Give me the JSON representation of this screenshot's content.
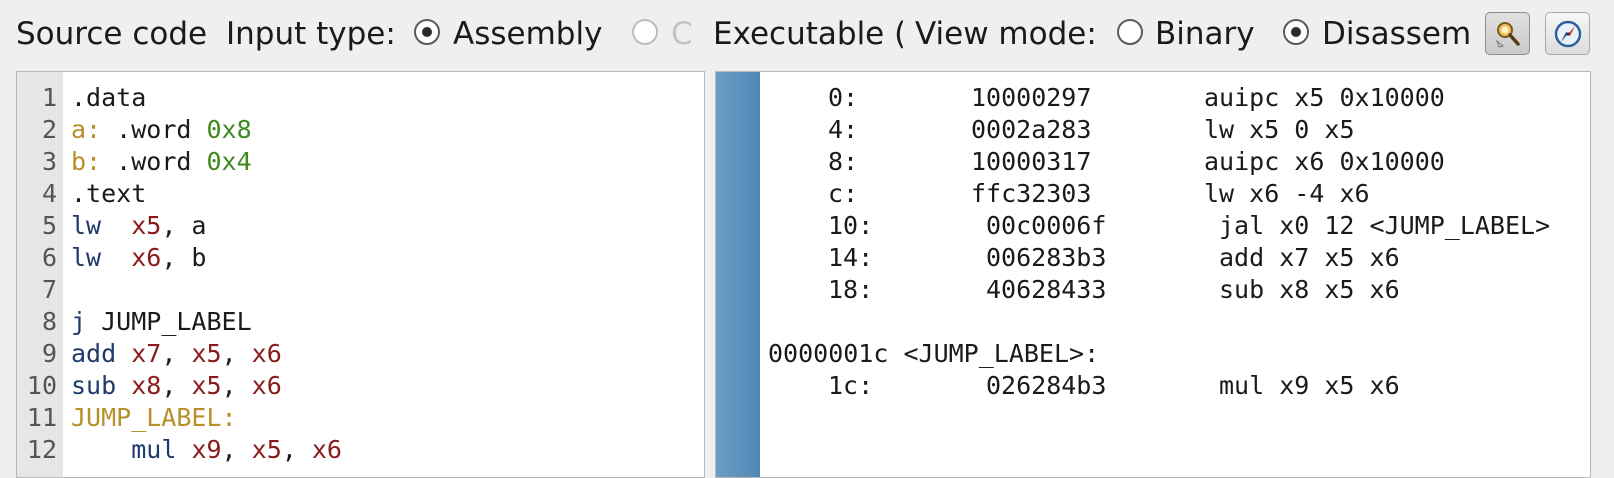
{
  "toolbar": {
    "source_code_label": "Source code",
    "input_type_label": "Input type:",
    "input_options": [
      {
        "label": "Assembly",
        "checked": true,
        "disabled": false
      },
      {
        "label": "C",
        "checked": false,
        "disabled": true
      },
      {
        "label": "Executable (",
        "checked": false,
        "disabled": false
      }
    ],
    "view_mode_label": "View mode:",
    "view_options": [
      {
        "label": "Binary",
        "checked": false
      },
      {
        "label": "Disassembly",
        "checked": true
      }
    ],
    "buttons": [
      {
        "icon": "inspect-icon",
        "active": true
      },
      {
        "icon": "compass-icon",
        "active": false
      }
    ]
  },
  "editor": {
    "line_numbers": [
      "1",
      "2",
      "3",
      "4",
      "5",
      "6",
      "7",
      "8",
      "9",
      "10",
      "11",
      "12"
    ],
    "lines": [
      [
        {
          "t": ".data",
          "c": "plain"
        }
      ],
      [
        {
          "t": "a:",
          "c": "lbl"
        },
        {
          "t": " .word ",
          "c": "plain"
        },
        {
          "t": "0x8",
          "c": "num"
        }
      ],
      [
        {
          "t": "b:",
          "c": "lbl"
        },
        {
          "t": " .word ",
          "c": "plain"
        },
        {
          "t": "0x4",
          "c": "num"
        }
      ],
      [
        {
          "t": ".text",
          "c": "plain"
        }
      ],
      [
        {
          "t": "lw",
          "c": "kw"
        },
        {
          "t": "  ",
          "c": "plain"
        },
        {
          "t": "x5",
          "c": "reg"
        },
        {
          "t": ", a",
          "c": "plain"
        }
      ],
      [
        {
          "t": "lw",
          "c": "kw"
        },
        {
          "t": "  ",
          "c": "plain"
        },
        {
          "t": "x6",
          "c": "reg"
        },
        {
          "t": ", b",
          "c": "plain"
        }
      ],
      [],
      [
        {
          "t": "j",
          "c": "kw"
        },
        {
          "t": " JUMP_LABEL",
          "c": "plain"
        }
      ],
      [
        {
          "t": "add",
          "c": "kw"
        },
        {
          "t": " ",
          "c": "plain"
        },
        {
          "t": "x7",
          "c": "reg"
        },
        {
          "t": ", ",
          "c": "plain"
        },
        {
          "t": "x5",
          "c": "reg"
        },
        {
          "t": ", ",
          "c": "plain"
        },
        {
          "t": "x6",
          "c": "reg"
        }
      ],
      [
        {
          "t": "sub",
          "c": "kw"
        },
        {
          "t": " ",
          "c": "plain"
        },
        {
          "t": "x8",
          "c": "reg"
        },
        {
          "t": ", ",
          "c": "plain"
        },
        {
          "t": "x5",
          "c": "reg"
        },
        {
          "t": ", ",
          "c": "plain"
        },
        {
          "t": "x6",
          "c": "reg"
        }
      ],
      [
        {
          "t": "JUMP_LABEL:",
          "c": "lbl"
        }
      ],
      [
        {
          "t": "    ",
          "c": "plain"
        },
        {
          "t": "mul",
          "c": "kw"
        },
        {
          "t": " ",
          "c": "plain"
        },
        {
          "t": "x9",
          "c": "reg"
        },
        {
          "t": ", ",
          "c": "plain"
        },
        {
          "t": "x5",
          "c": "reg"
        },
        {
          "t": ", ",
          "c": "plain"
        },
        {
          "t": "x6",
          "c": "reg"
        }
      ]
    ]
  },
  "disassembly": {
    "rows": [
      {
        "addr": "0:",
        "hex": "10000297",
        "instr": "auipc x5 0x10000"
      },
      {
        "addr": "4:",
        "hex": "0002a283",
        "instr": "lw x5 0 x5"
      },
      {
        "addr": "8:",
        "hex": "10000317",
        "instr": "auipc x6 0x10000"
      },
      {
        "addr": "c:",
        "hex": "ffc32303",
        "instr": "lw x6 -4 x6"
      },
      {
        "addr": "10:",
        "hex": "00c0006f",
        "instr": "jal x0 12 <JUMP_LABEL>"
      },
      {
        "addr": "14:",
        "hex": "006283b3",
        "instr": "add x7 x5 x6"
      },
      {
        "addr": "18:",
        "hex": "40628433",
        "instr": "sub x8 x5 x6"
      },
      {
        "blank": true
      },
      {
        "label": "0000001c <JUMP_LABEL>:"
      },
      {
        "addr": "1c:",
        "hex": "026284b3",
        "instr": "mul x9 x5 x6"
      }
    ]
  }
}
